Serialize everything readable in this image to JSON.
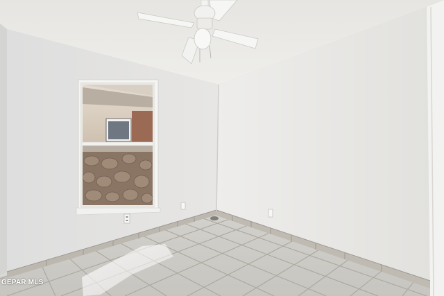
{
  "watermark": {
    "text": "GEPAR MLS"
  },
  "colors": {
    "wall_left": "#e4e4e1",
    "wall_right": "#ecebe9",
    "ceiling": "#ecebe8",
    "floor_tile": "#cfcdc8",
    "grout": "#a9a6a0",
    "baseboard": "#bdb9b1",
    "window_frame": "#f4f4f2",
    "stone": "#8d7b6a",
    "fan": "#f2f2f0"
  },
  "icons": [
    "ceiling-fan-icon",
    "window-icon",
    "electrical-outlet-icon"
  ]
}
